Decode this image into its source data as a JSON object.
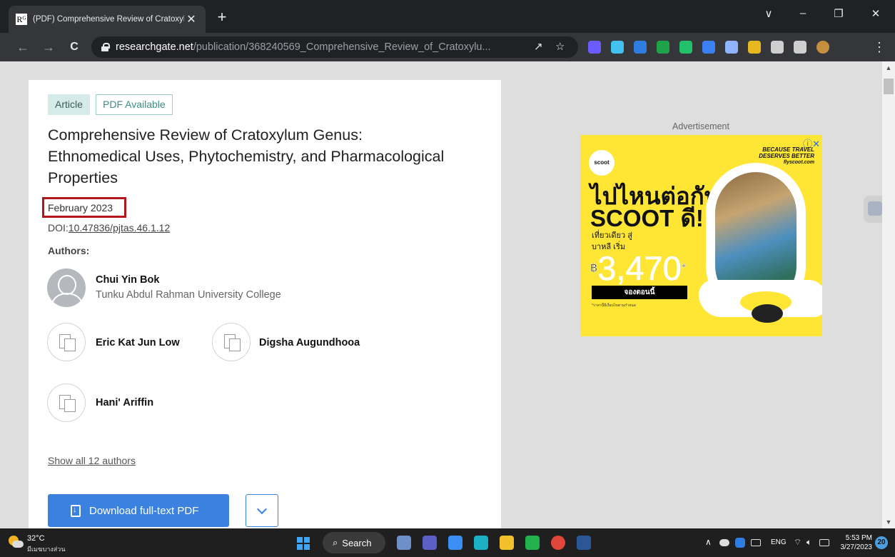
{
  "browser": {
    "tab": {
      "favicon": "Rᴳ",
      "title": "(PDF) Comprehensive Review of Cratoxylum",
      "close_glyph": "✕"
    },
    "new_tab_glyph": "+",
    "window_controls": {
      "dropdown": "∨",
      "minimize": "–",
      "restore": "❐",
      "close": "✕"
    },
    "nav": {
      "back": "←",
      "forward": "→",
      "reload": "C"
    },
    "url_host": "researchgate.net",
    "url_path": "/publication/368240569_Comprehensive_Review_of_Cratoxylu...",
    "omnibox_icons": {
      "share": "↗",
      "bookmark": "☆"
    },
    "menu_glyph": "⋮",
    "extension_colors": [
      "#6b5cff",
      "#43c1f0",
      "#2f7de1",
      "#1fa34a",
      "#21c06a",
      "#3b7ff5",
      "#8fb3ff",
      "#e8b820",
      "#cfcfcf",
      "#cfcfcf",
      "#c68f3f"
    ]
  },
  "article": {
    "type_badge": "Article",
    "pdf_badge": "PDF Available",
    "title": "Comprehensive Review of Cratoxylum Genus: Ethnomedical Uses, Phytochemistry, and Pharmacological Properties",
    "date": "February 2023",
    "doi_prefix": "DOI:",
    "doi": "10.47836/pjtas.46.1.12",
    "authors_heading": "Authors:",
    "authors": [
      {
        "name": "Chui Yin Bok",
        "institution": "Tunku Abdul Rahman University College"
      },
      {
        "name": "Eric Kat Jun Low"
      },
      {
        "name": "Digsha Augundhooa"
      },
      {
        "name": "Hani' Ariffin"
      }
    ],
    "show_all": "Show all 12 authors",
    "download_label": "Download full-text PDF"
  },
  "ad": {
    "label": "Advertisement",
    "close": "ⓘ✕",
    "logo": "scoot",
    "tagline_1": "BECAUSE TRAVEL",
    "tagline_2": "DESERVES BETTER",
    "tagline_3": "flyscoot.com",
    "headline_1": "ไปไหนต่อกับ",
    "headline_2": "SCOOT ดี!",
    "sub_1": "เที่ยวเดียว สู่",
    "sub_2": "บาหลี เริ่ม",
    "currency": "฿",
    "price": "3,470",
    "price_mark": "*",
    "cta": "จองตอนนี้",
    "fineprint": "*ราคานี้มีเงื่อนไขตามกำหนด"
  },
  "scrollbar": {
    "up": "▲",
    "down": "▼"
  },
  "taskbar": {
    "temp": "32°C",
    "weather": "มีเมฆบางส่วน",
    "search": "Search",
    "search_glyph": "⌕",
    "app_colors": [
      "#6e8fc8",
      "#5b5fc7",
      "#3a8ef6",
      "#1bb0c4",
      "#f2c02a",
      "#22b14c",
      "#e0463a",
      "#2b5797"
    ],
    "tray_chevron": "∧",
    "language": "ENG",
    "time": "5:53 PM",
    "date": "3/27/2023",
    "notifications": "20"
  }
}
